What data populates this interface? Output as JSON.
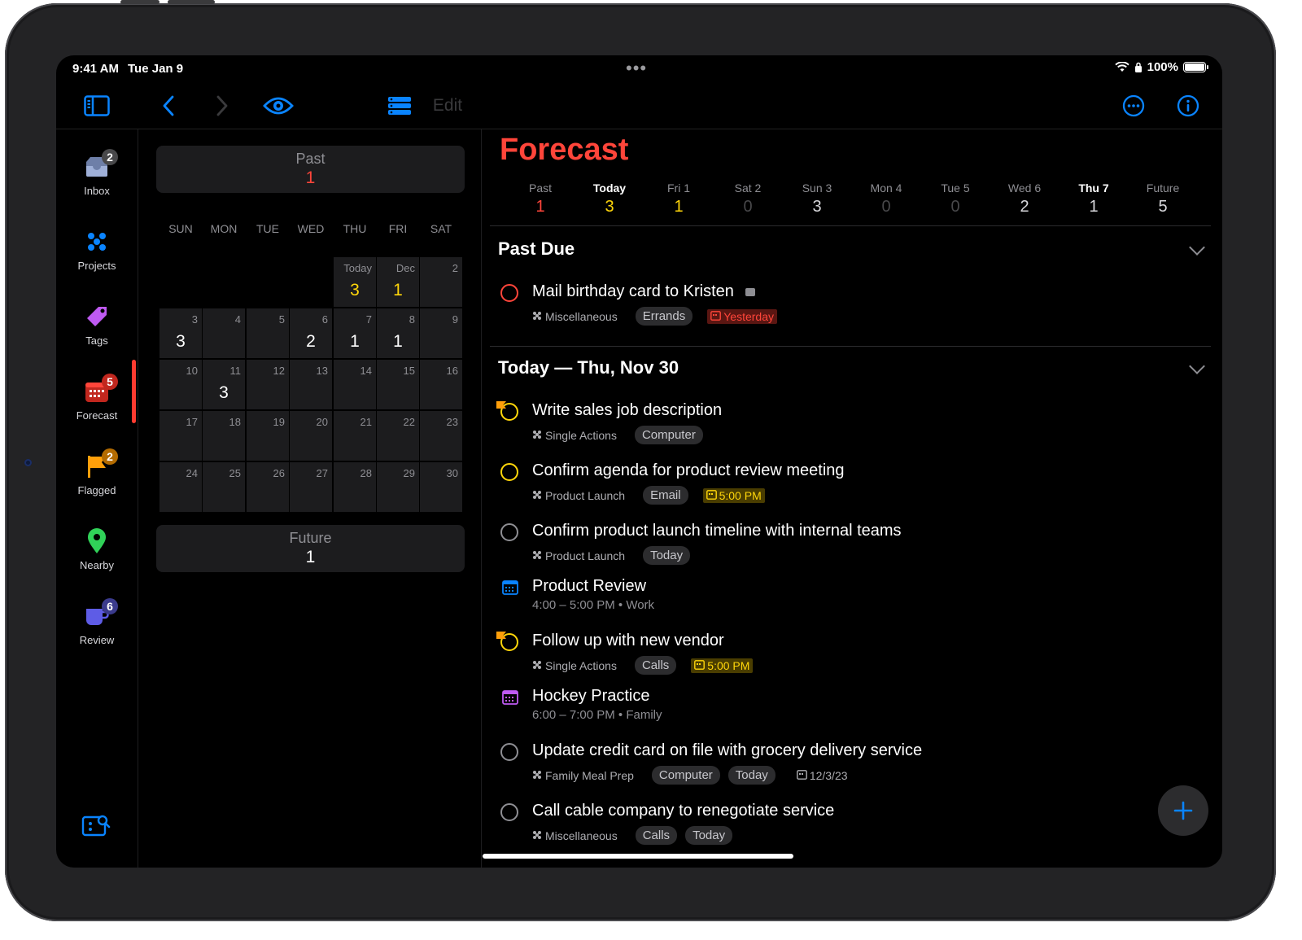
{
  "status": {
    "time": "9:41 AM",
    "date": "Tue Jan 9",
    "battery": "100%"
  },
  "toolbar": {
    "edit_label": "Edit"
  },
  "sidebar": {
    "items": [
      {
        "label": "Inbox",
        "badge": "2"
      },
      {
        "label": "Projects"
      },
      {
        "label": "Tags"
      },
      {
        "label": "Forecast",
        "badge": "5"
      },
      {
        "label": "Flagged",
        "badge": "2"
      },
      {
        "label": "Nearby"
      },
      {
        "label": "Review",
        "badge": "6"
      }
    ]
  },
  "calendar": {
    "past": {
      "label": "Past",
      "count": "1"
    },
    "future": {
      "label": "Future",
      "count": "1"
    },
    "weekdays": [
      "SUN",
      "MON",
      "TUE",
      "WED",
      "THU",
      "FRI",
      "SAT"
    ],
    "weeks": [
      [
        {
          "blank": true
        },
        {
          "blank": true
        },
        {
          "blank": true
        },
        {
          "blank": true
        },
        {
          "d": "Today",
          "c": "3",
          "accent": "#ffd60a"
        },
        {
          "d": "Dec",
          "c": "1",
          "accent": "#ffd60a"
        },
        {
          "d": "2",
          "c": ""
        }
      ],
      [
        {
          "d": "3",
          "c": "3"
        },
        {
          "d": "4",
          "c": ""
        },
        {
          "d": "5",
          "c": ""
        },
        {
          "d": "6",
          "c": "2"
        },
        {
          "d": "7",
          "c": "1"
        },
        {
          "d": "8",
          "c": "1"
        },
        {
          "d": "9",
          "c": ""
        }
      ],
      [
        {
          "d": "10",
          "c": ""
        },
        {
          "d": "11",
          "c": "3"
        },
        {
          "d": "12",
          "c": ""
        },
        {
          "d": "13",
          "c": ""
        },
        {
          "d": "14",
          "c": ""
        },
        {
          "d": "15",
          "c": ""
        },
        {
          "d": "16",
          "c": ""
        }
      ],
      [
        {
          "d": "17",
          "c": ""
        },
        {
          "d": "18",
          "c": ""
        },
        {
          "d": "19",
          "c": ""
        },
        {
          "d": "20",
          "c": ""
        },
        {
          "d": "21",
          "c": ""
        },
        {
          "d": "22",
          "c": ""
        },
        {
          "d": "23",
          "c": ""
        }
      ],
      [
        {
          "d": "24",
          "c": ""
        },
        {
          "d": "25",
          "c": ""
        },
        {
          "d": "26",
          "c": ""
        },
        {
          "d": "27",
          "c": ""
        },
        {
          "d": "28",
          "c": ""
        },
        {
          "d": "29",
          "c": ""
        },
        {
          "d": "30",
          "c": ""
        }
      ]
    ]
  },
  "main": {
    "title": "Forecast",
    "forecast_bar": [
      {
        "label": "Past",
        "count": "1",
        "color": "#ff453a"
      },
      {
        "label": "Today",
        "count": "3",
        "color": "#ffd60a",
        "bold": true
      },
      {
        "label": "Fri 1",
        "count": "1",
        "color": "#ffd60a"
      },
      {
        "label": "Sat 2",
        "count": "0",
        "color": "#48484a"
      },
      {
        "label": "Sun 3",
        "count": "3",
        "color": "#d8d8dc"
      },
      {
        "label": "Mon 4",
        "count": "0",
        "color": "#48484a"
      },
      {
        "label": "Tue 5",
        "count": "0",
        "color": "#48484a"
      },
      {
        "label": "Wed 6",
        "count": "2",
        "color": "#d8d8dc"
      },
      {
        "label": "Thu 7",
        "count": "1",
        "color": "#d8d8dc",
        "bold": true
      },
      {
        "label": "Future",
        "count": "5",
        "color": "#d8d8dc"
      }
    ],
    "sections": {
      "past_due": "Past Due",
      "today": "Today — Thu, Nov 30"
    },
    "items": [
      {
        "kind": "task",
        "name": "Mail birthday card to Kristen",
        "circle": "#ff453a",
        "note": true,
        "project": "Miscellaneous",
        "tags": [
          "Errands"
        ],
        "due": {
          "text": "Yesterday",
          "style": "red"
        }
      },
      {
        "kind": "task",
        "name": "Write sales job description",
        "circle": "#ffd60a",
        "flag": true,
        "project": "Single Actions",
        "tags": [
          "Computer"
        ]
      },
      {
        "kind": "task",
        "name": "Confirm agenda for product review meeting",
        "circle": "#ffd60a",
        "project": "Product Launch",
        "tags": [
          "Email"
        ],
        "due": {
          "text": "5:00 PM",
          "style": "yellow"
        }
      },
      {
        "kind": "task",
        "name": "Confirm product launch timeline with internal teams",
        "circle": "#8e8e93",
        "project": "Product Launch",
        "tags": [
          "Today"
        ]
      },
      {
        "kind": "event",
        "name": "Product Review",
        "sub": "4:00 – 5:00 PM • Work",
        "color": "#0a84ff"
      },
      {
        "kind": "task",
        "name": "Follow up with new vendor",
        "circle": "#ffd60a",
        "flag": true,
        "project": "Single Actions",
        "tags": [
          "Calls"
        ],
        "due": {
          "text": "5:00 PM",
          "style": "yellow"
        }
      },
      {
        "kind": "event",
        "name": "Hockey Practice",
        "sub": "6:00 – 7:00 PM • Family",
        "color": "#bf5af2"
      },
      {
        "kind": "task",
        "name": "Update credit card on file with grocery delivery service",
        "circle": "#8e8e93",
        "project": "Family Meal Prep",
        "tags": [
          "Computer",
          "Today"
        ],
        "due": {
          "text": "12/3/23",
          "style": "plain"
        }
      },
      {
        "kind": "task",
        "name": "Call cable company to renegotiate service",
        "circle": "#8e8e93",
        "project": "Miscellaneous",
        "tags": [
          "Calls",
          "Today"
        ]
      }
    ]
  },
  "colors": {
    "accent": "#0a84ff",
    "forecast_red": "#ff453a",
    "due_yellow": "#ffd60a"
  }
}
